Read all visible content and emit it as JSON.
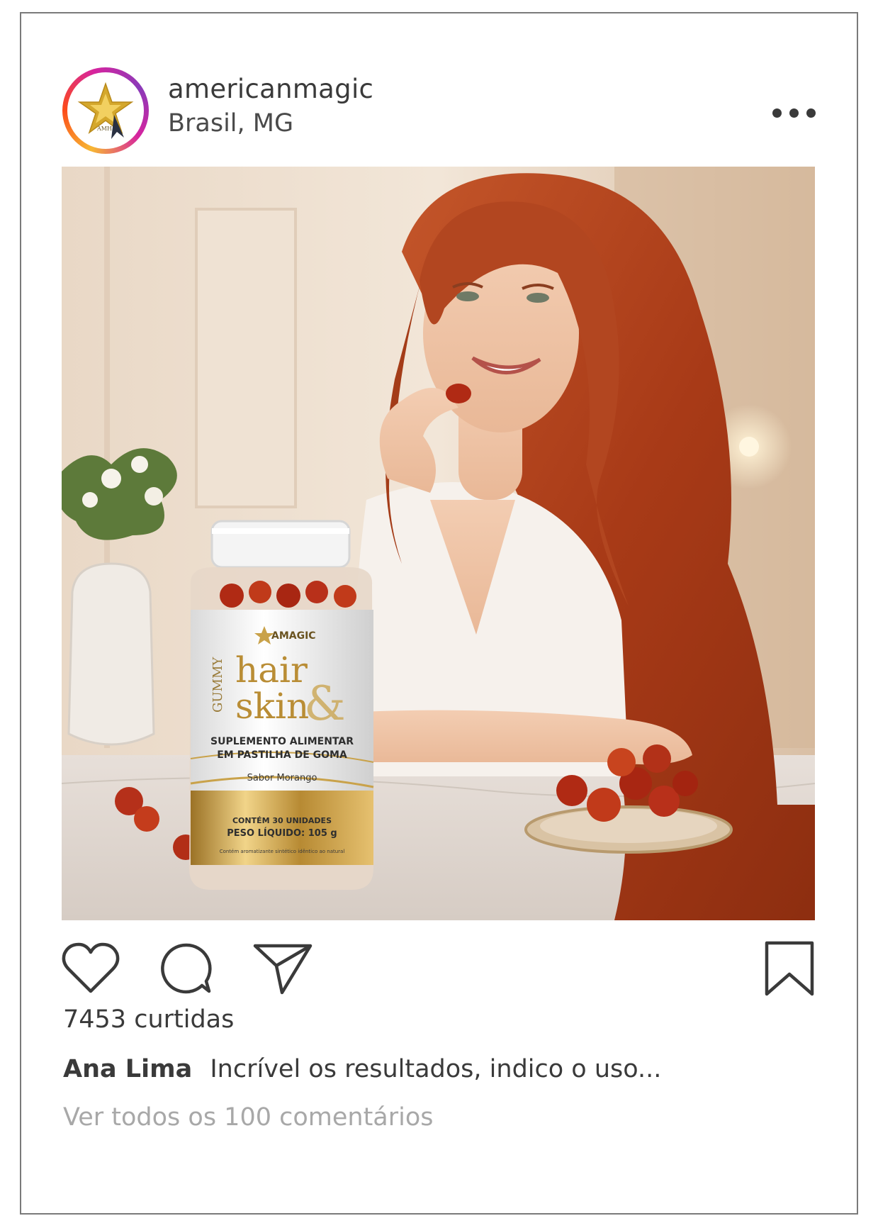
{
  "post": {
    "username": "americanmagic",
    "location": "Brasil, MG",
    "avatar_logo_text": "AMH",
    "product": {
      "brand": "AMAGIC",
      "line": "GUMMY",
      "title_line1": "hair",
      "title_line2": "skin",
      "ampersand": "&",
      "desc_line1": "SUPLEMENTO ALIMENTAR",
      "desc_line2": "EM PASTILHA DE GOMA",
      "flavor": "Sabor Morango",
      "units": "CONTÉM 30 UNIDADES",
      "weight": "PESO LÍQUIDO: 105 g",
      "note": "Contém aromatizante sintético idêntico ao natural"
    },
    "likes_text": "7453 curtidas",
    "caption_author": "Ana Lima",
    "caption_text": "Incrível os resultados, indico o uso...",
    "comments_link": "Ver todos os 100 comentários"
  },
  "icons": {
    "like": "heart-icon",
    "comment": "comment-bubble-icon",
    "share": "paper-plane-icon",
    "save": "bookmark-icon",
    "more": "more-dots-icon"
  },
  "colors": {
    "text": "#3a3a3a",
    "muted": "#a8a8a8",
    "hair": "#b6471f",
    "gold": "#c9a24a",
    "gummy": "#b02a14"
  }
}
